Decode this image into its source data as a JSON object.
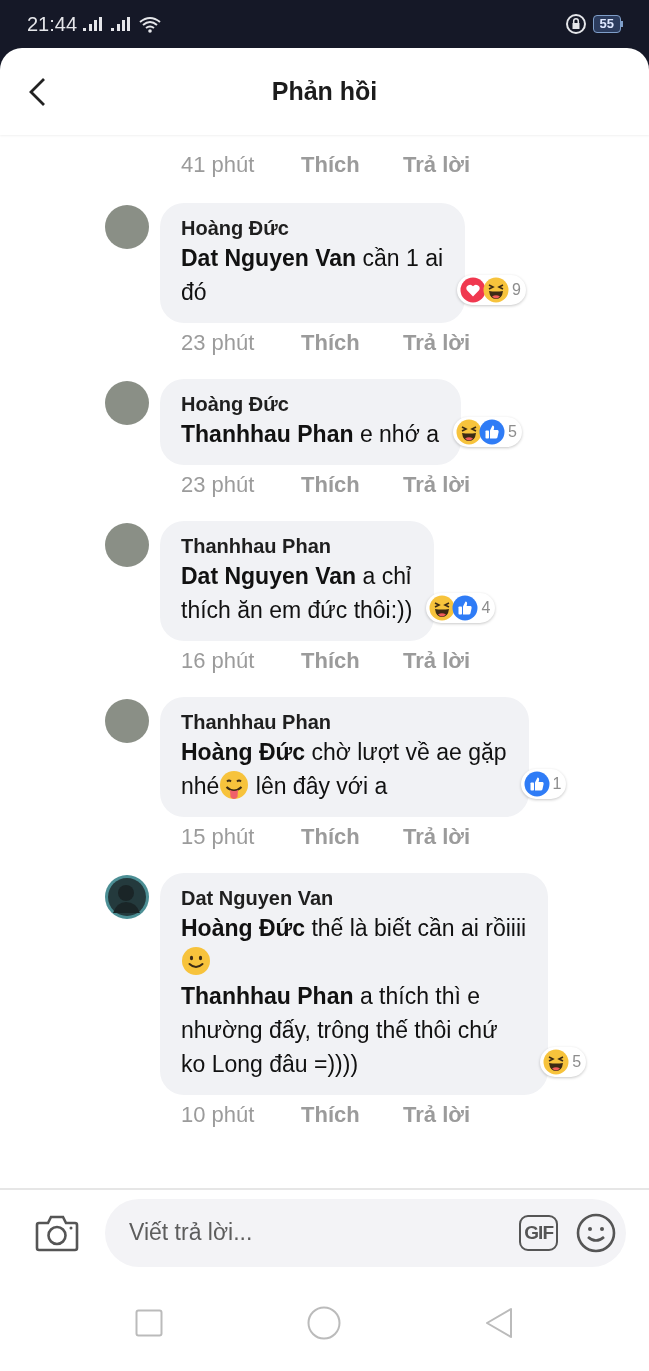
{
  "status_bar": {
    "time": "21:44",
    "battery": "55"
  },
  "header": {
    "title": "Phản hồi"
  },
  "previous_comment": {
    "time": "41 phút",
    "like": "Thích",
    "reply": "Trả lời"
  },
  "comments": [
    {
      "author": "Hoàng Đức",
      "avatar": {
        "kind": "photo"
      },
      "lines": [
        [
          {
            "kind": "text",
            "text": "**Dat Nguyen Van** cần 1 ai\nđó"
          }
        ]
      ],
      "time": "23 phút",
      "like": "Thích",
      "reply": "Trả lời",
      "reactions": {
        "items": [
          {
            "kind": "love"
          },
          {
            "kind": "haha"
          }
        ],
        "count": "9"
      }
    },
    {
      "author": "Hoàng Đức",
      "avatar": {
        "kind": "photo"
      },
      "lines": [
        [
          {
            "kind": "text",
            "text": "**Thanhhau Phan** e nhớ a"
          }
        ]
      ],
      "time": "23 phút",
      "like": "Thích",
      "reply": "Trả lời",
      "reactions": {
        "items": [
          {
            "kind": "haha"
          },
          {
            "kind": "like"
          }
        ],
        "count": "5"
      }
    },
    {
      "author": "Thanhhau Phan",
      "avatar": {
        "kind": "photo"
      },
      "lines": [
        [
          {
            "kind": "text",
            "text": "**Dat Nguyen Van**  a chỉ\nthích ăn em đức thôi:))"
          }
        ]
      ],
      "time": "16 phút",
      "like": "Thích",
      "reply": "Trả lời",
      "reactions": {
        "items": [
          {
            "kind": "haha"
          },
          {
            "kind": "like"
          }
        ],
        "count": "4"
      }
    },
    {
      "author": "Thanhhau Phan",
      "avatar": {
        "kind": "photo"
      },
      "lines": [
        [
          {
            "kind": "text",
            "text": "**Hoàng Đức**  chờ lượt về ae gặp"
          }
        ],
        [
          {
            "kind": "text",
            "text": "nhé"
          },
          {
            "kind": "tongue"
          },
          {
            "kind": "text",
            "text": " lên đây với a"
          }
        ]
      ],
      "time": "15 phút",
      "like": "Thích",
      "reply": "Trả lời",
      "reactions": {
        "items": [
          {
            "kind": "like"
          }
        ],
        "count": "1"
      }
    },
    {
      "author": "Dat Nguyen Van",
      "avatar": {
        "kind": "silhouette"
      },
      "lines": [
        [
          {
            "kind": "text",
            "text": "**Hoàng Đức** thế là biết cần ai rồiiii"
          }
        ],
        [
          {
            "kind": "smiley"
          }
        ],
        [
          {
            "kind": "text",
            "text": "**Thanhhau Phan** a thích thì e\nnhường đấy, trông thế thôi chứ\nko Long đâu =))))"
          }
        ]
      ],
      "time": "10 phút",
      "like": "Thích",
      "reply": "Trả lời",
      "reactions": {
        "items": [
          {
            "kind": "haha"
          }
        ],
        "count": "5"
      }
    }
  ],
  "composer": {
    "placeholder": "Viết trả lời...",
    "gif": "GIF"
  }
}
